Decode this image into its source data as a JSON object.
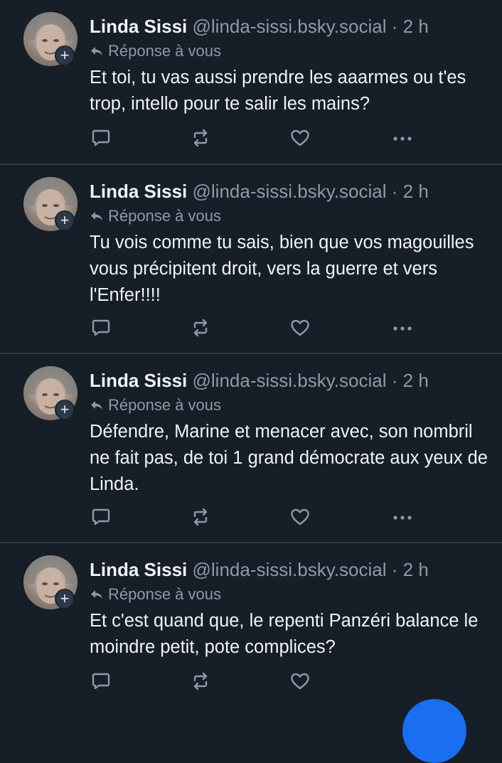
{
  "posts": [
    {
      "author_name": "Linda Sissi",
      "author_handle": "@linda-sissi.bsky.social",
      "separator": "·",
      "time": "2 h",
      "reply_label": "Réponse à vous",
      "text": "Et toi, tu vas aussi prendre les aaarmes ou t'es trop, intello pour te salir les mains?"
    },
    {
      "author_name": "Linda Sissi",
      "author_handle": "@linda-sissi.bsky.social",
      "separator": "·",
      "time": "2 h",
      "reply_label": "Réponse à vous",
      "text": "Tu vois comme tu sais, bien que vos magouilles vous précipitent droit, vers la guerre et vers l'Enfer!!!!"
    },
    {
      "author_name": "Linda Sissi",
      "author_handle": "@linda-sissi.bsky.social",
      "separator": "·",
      "time": "2 h",
      "reply_label": "Réponse à vous",
      "text": "Défendre, Marine et menacer avec, son nombril  ne fait pas, de toi 1 grand démocrate aux yeux de Linda."
    },
    {
      "author_name": "Linda Sissi",
      "author_handle": "@linda-sissi.bsky.social",
      "separator": "·",
      "time": "2 h",
      "reply_label": "Réponse à vous",
      "text": "Et c'est quand que, le repenti Panzéri balance le moindre petit, pote complices?"
    }
  ],
  "icons": {
    "avatar_badge": "plus-icon",
    "reply": "reply-arrow-icon",
    "comment": "speech-bubble-icon",
    "repost": "repost-arrows-icon",
    "like": "heart-icon",
    "more": "ellipsis-icon"
  },
  "colors": {
    "background": "#161e27",
    "divider": "#2e3945",
    "text_primary": "#f1f3f5",
    "text_secondary": "#8d9aaa",
    "fab": "#1a6ef0"
  }
}
